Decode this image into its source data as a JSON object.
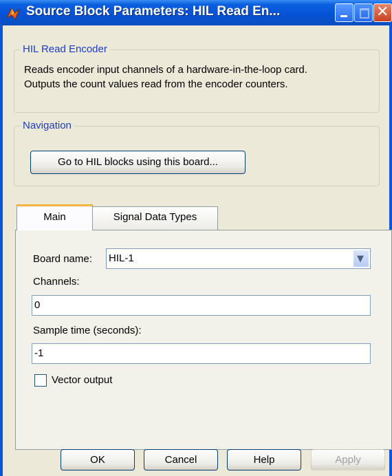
{
  "window": {
    "title": "Source Block Parameters: HIL Read En..."
  },
  "description_group": {
    "legend": "HIL Read Encoder",
    "line1": "Reads encoder input channels of a hardware-in-the-loop card.",
    "line2": "Outputs the count values read from the encoder counters."
  },
  "navigation_group": {
    "legend": "Navigation",
    "goto_button": "Go to HIL blocks using this board..."
  },
  "tabs": [
    {
      "label": "Main",
      "active": true
    },
    {
      "label": "Signal Data Types",
      "active": false
    }
  ],
  "main": {
    "board_name_label": "Board name:",
    "board_name_value": "HIL-1",
    "channels_label": "Channels:",
    "channels_value": "0",
    "sample_time_label": "Sample time (seconds):",
    "sample_time_value": "-1",
    "vector_output_label": "Vector output",
    "vector_output_checked": false
  },
  "buttons": {
    "ok": "OK",
    "cancel": "Cancel",
    "help": "Help",
    "apply": "Apply"
  },
  "colors": {
    "titlebar": "#0650d4",
    "legend_text": "#1c3cc8",
    "tab_highlight": "#f4b33b",
    "dialog_bg": "#ece9d8"
  },
  "icons": {
    "app": "simulink-app-icon",
    "minimize": "minimize-icon",
    "maximize": "maximize-icon",
    "close": "close-icon",
    "dropdown": "chevron-down-icon"
  }
}
